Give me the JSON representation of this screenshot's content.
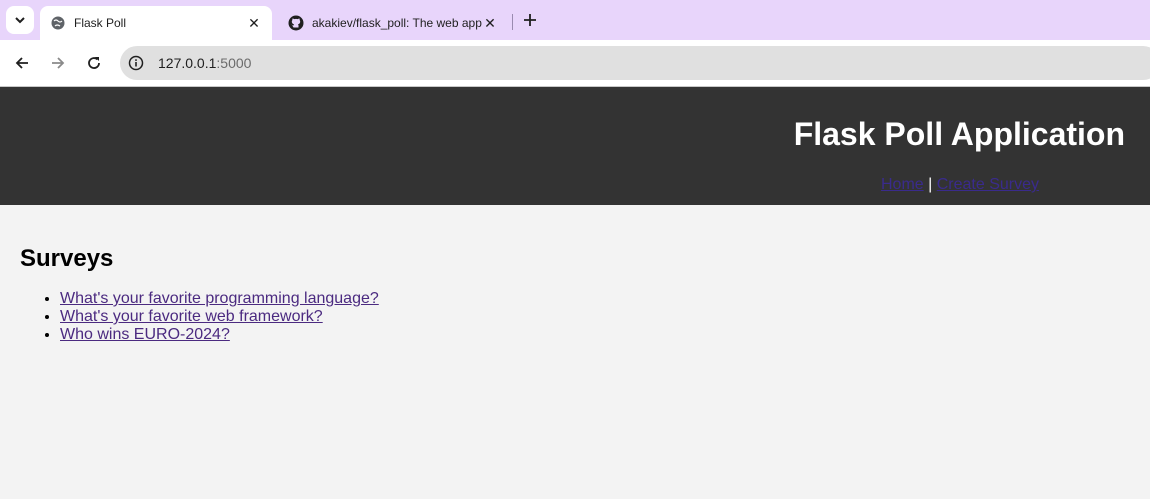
{
  "browser": {
    "tabs": [
      {
        "title": "Flask Poll",
        "active": true,
        "icon": "globe-icon"
      },
      {
        "title": "akakiev/flask_poll: The web app",
        "active": false,
        "icon": "github-icon"
      }
    ],
    "url_host": "127.0.0.1",
    "url_port": ":5000"
  },
  "page": {
    "title": "Flask Poll Application",
    "nav": {
      "home": "Home",
      "separator": "|",
      "create": "Create Survey"
    },
    "heading": "Surveys",
    "surveys": [
      "What's your favorite programming language?",
      "What's your favorite web framework?",
      "Who wins EURO-2024?"
    ]
  },
  "colors": {
    "header_bg": "#333333",
    "page_bg": "#f3f3f3",
    "tabstrip_bg": "#e8d5fb",
    "link_visited": "#4b2a80"
  }
}
